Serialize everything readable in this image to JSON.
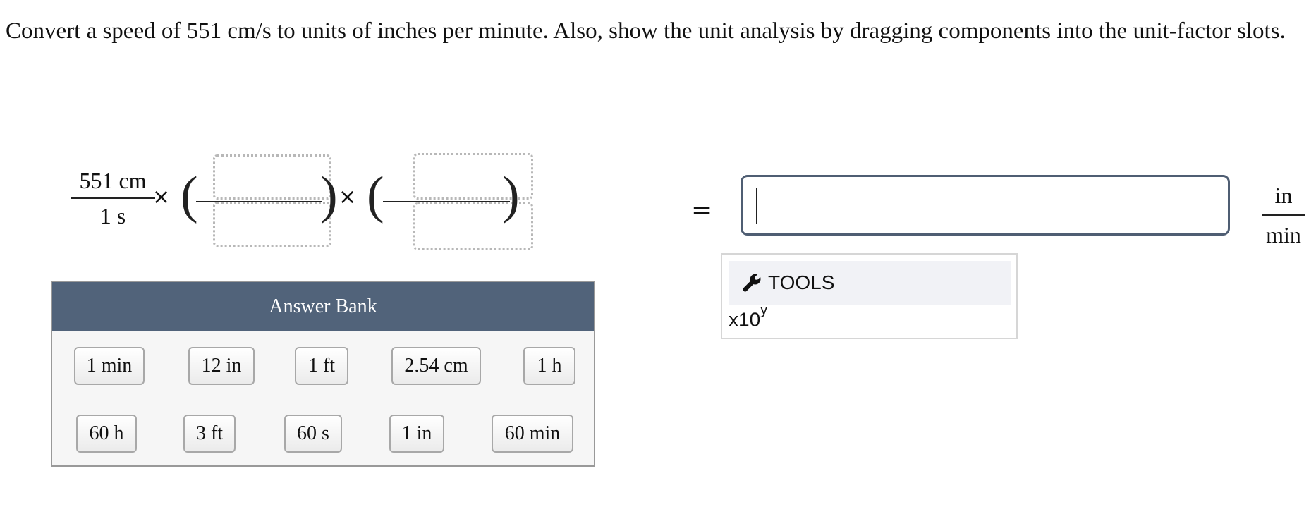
{
  "question": "Convert a speed of 551 cm/s to units of inches per minute. Also, show the unit analysis by dragging components into the unit-factor slots.",
  "given": {
    "numerator": "551 cm",
    "denominator": "1 s"
  },
  "times_symbol": "×",
  "paren_open": "(",
  "paren_close": ")",
  "equals": "=",
  "answer": {
    "value": "",
    "unit_numerator": "in",
    "unit_denominator": "min"
  },
  "tools": {
    "label": "TOOLS",
    "sci_base": "x10",
    "sci_exp": "y"
  },
  "answer_bank": {
    "title": "Answer Bank",
    "row1": [
      "1 min",
      "12 in",
      "1 ft",
      "2.54 cm",
      "1 h"
    ],
    "row2": [
      "60 h",
      "3 ft",
      "60 s",
      "1 in",
      "60 min"
    ]
  },
  "colors": {
    "bank_header": "#51637a",
    "input_border": "#4f5e73",
    "slot_border": "#b8b8b8"
  }
}
